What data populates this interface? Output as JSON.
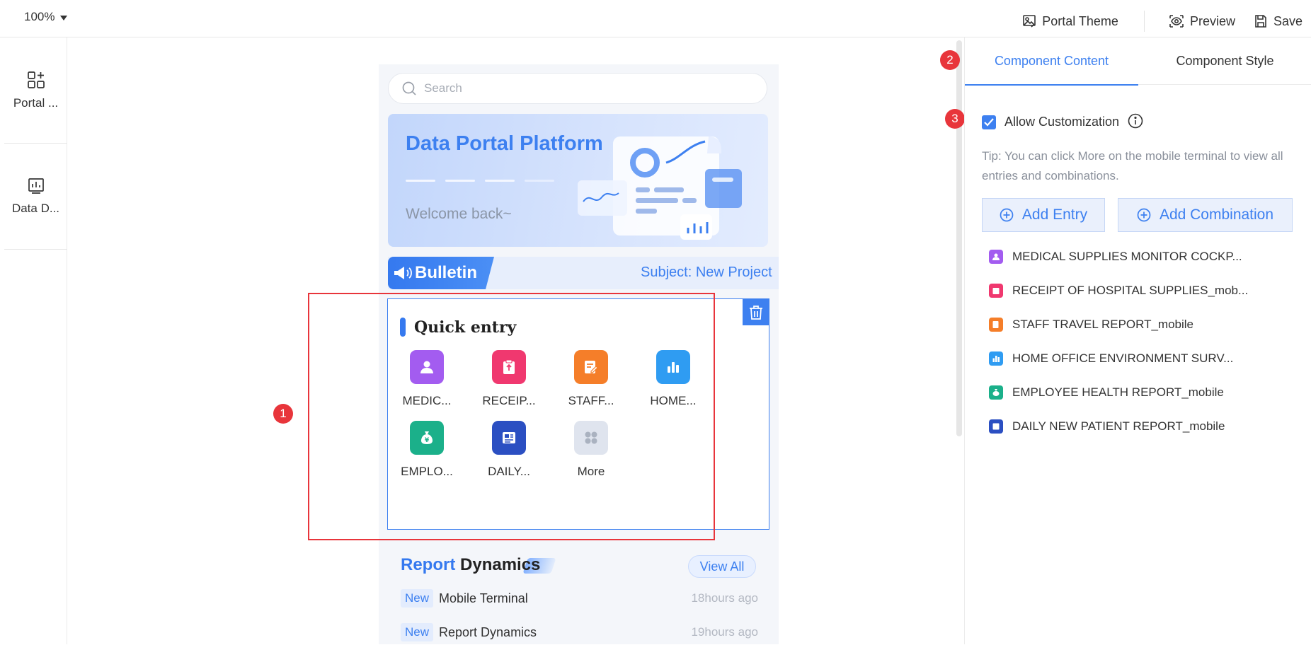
{
  "toolbar": {
    "zoom": "100%",
    "portal_theme": "Portal Theme",
    "preview": "Preview",
    "save": "Save"
  },
  "sidebar": {
    "items": [
      {
        "label": "Portal ...",
        "icon": "add-component-icon"
      },
      {
        "label": "Data D...",
        "icon": "chart-icon"
      }
    ]
  },
  "phone": {
    "search_placeholder": "Search",
    "banner": {
      "title": "Data Portal Platform",
      "subtitle": "Welcome back~"
    },
    "bulletin": {
      "label": "Bulletin",
      "subject": "Subject: New Project"
    },
    "quick_entry": {
      "title": "Quick entry",
      "entries": [
        {
          "label": "MEDIC...",
          "color": "#a35cf0",
          "icon": "user-icon"
        },
        {
          "label": "RECEIP...",
          "color": "#f0386f",
          "icon": "clipboard-upload-icon"
        },
        {
          "label": "STAFF...",
          "color": "#f57e29",
          "icon": "edit-document-icon"
        },
        {
          "label": "HOME...",
          "color": "#2f9cf2",
          "icon": "bar-chart-icon"
        },
        {
          "label": "EMPLO...",
          "color": "#1bb08a",
          "icon": "money-bag-icon"
        },
        {
          "label": "DAILY...",
          "color": "#2b4fc2",
          "icon": "news-icon"
        },
        {
          "label": "More",
          "color": "#dfe4ee",
          "icon": "more-grid-icon"
        }
      ]
    },
    "report": {
      "title_highlight": "Report",
      "title_rest": " Dynamics",
      "view_all": "View All",
      "items": [
        {
          "badge": "New",
          "text": "Mobile Terminal",
          "time": "18hours ago"
        },
        {
          "badge": "New",
          "text": "Report Dynamics",
          "time": "19hours ago"
        }
      ]
    }
  },
  "annotations": [
    "1",
    "2",
    "3"
  ],
  "right_panel": {
    "tabs": [
      "Component Content",
      "Component Style"
    ],
    "allow_customization": "Allow Customization",
    "tip": "Tip: You can click More on the mobile terminal to view all entries and combinations.",
    "add_entry": "Add Entry",
    "add_combination": "Add Combination",
    "entries": [
      {
        "label": "MEDICAL SUPPLIES MONITOR COCKP...",
        "color": "#a35cf0"
      },
      {
        "label": "RECEIPT OF HOSPITAL SUPPLIES_mob...",
        "color": "#f0386f"
      },
      {
        "label": "STAFF TRAVEL REPORT_mobile",
        "color": "#f57e29"
      },
      {
        "label": "HOME OFFICE ENVIRONMENT SURV...",
        "color": "#2f9cf2"
      },
      {
        "label": "EMPLOYEE HEALTH REPORT_mobile",
        "color": "#1bb08a"
      },
      {
        "label": "DAILY NEW PATIENT REPORT_mobile",
        "color": "#2b4fc2"
      }
    ]
  },
  "colors": {
    "accent": "#3d80f0",
    "highlight": "#e8353b"
  }
}
